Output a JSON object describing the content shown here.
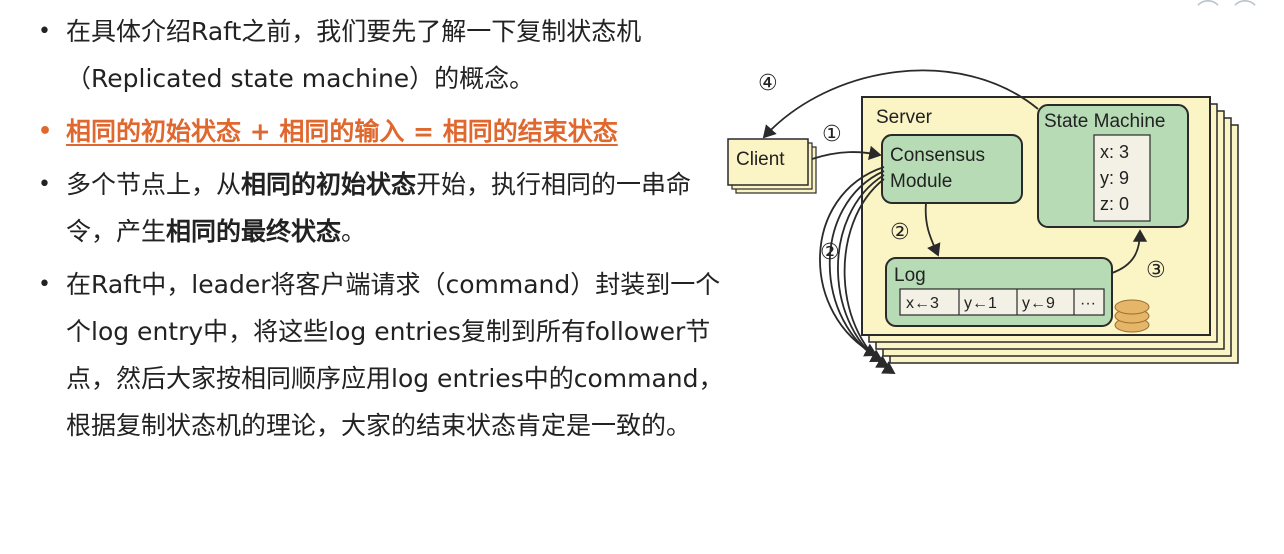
{
  "bullets": {
    "b1": "在具体介绍Raft之前，我们要先了解一下复制状态机（Replicated state machine）的概念。",
    "b2": "相同的初始状态 + 相同的输入 = 相同的结束状态",
    "b3": {
      "p1": "多个节点上，从",
      "bold1": "相同的初始状态",
      "p2": "开始，执行相同的一串命令，产生",
      "bold2": "相同的最终状态",
      "p3": "。"
    },
    "b4": "在Raft中，leader将客户端请求（command）封装到一个个log entry中，将这些log entries复制到所有follower节点，然后大家按相同顺序应用log entries中的command，根据复制状态机的理论，大家的结束状态肯定是一致的。"
  },
  "diagram": {
    "client": "Client",
    "server": "Server",
    "consensus_l1": "Consensus",
    "consensus_l2": "Module",
    "state_machine": "State Machine",
    "sm_x": "x: 3",
    "sm_y": "y: 9",
    "sm_z": "z: 0",
    "log": "Log",
    "log_e1": "x←3",
    "log_e2": "y←1",
    "log_e3": "y←9",
    "log_e4": "···",
    "step1": "①",
    "step2": "②",
    "step3": "③",
    "step4": "④"
  },
  "colors": {
    "highlight": "#e0672e",
    "server_fill": "#fbf4c4",
    "module_fill": "#b7dcb5",
    "box_stroke": "#2a2a2a",
    "stack_fill": "#e5b568"
  }
}
